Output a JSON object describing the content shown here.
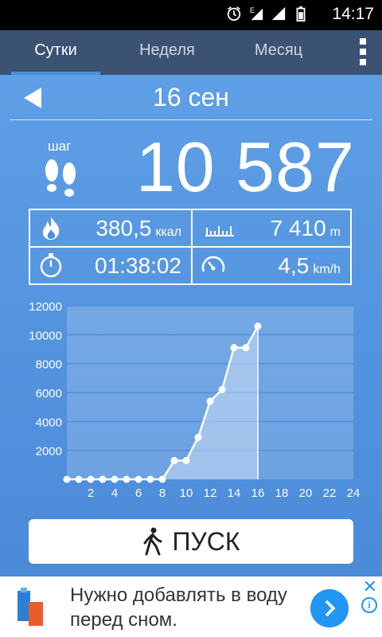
{
  "status_bar": {
    "time": "14:17",
    "network_label": "E"
  },
  "tabs": [
    {
      "label": "Сутки",
      "active": true
    },
    {
      "label": "Неделя",
      "active": false
    },
    {
      "label": "Месяц",
      "active": false
    }
  ],
  "date": "16 сен",
  "steps": {
    "label": "шаг",
    "value": "10 587"
  },
  "stats": {
    "energy": {
      "value": "380,5",
      "unit": "ккал"
    },
    "distance": {
      "value": "7 410",
      "unit": "m"
    },
    "duration": {
      "value": "01:38:02",
      "unit": ""
    },
    "speed": {
      "value": "4,5",
      "unit": "km/h"
    }
  },
  "start_button": {
    "label": "ПУСК"
  },
  "ad": {
    "text": "Нужно добавлять в воду перед сном.",
    "close": "✕",
    "info": "i"
  },
  "colors": {
    "background": "#4d8edb",
    "tabbar": "#3c5272",
    "ad_accent": "#2196f3"
  },
  "chart_data": {
    "type": "line",
    "x": [
      0,
      1,
      2,
      3,
      4,
      5,
      6,
      7,
      8,
      9,
      10,
      11,
      12,
      13,
      14,
      15,
      16
    ],
    "values": [
      0,
      0,
      0,
      0,
      0,
      0,
      0,
      0,
      0,
      1300,
      1300,
      2900,
      5400,
      6200,
      9100,
      9100,
      10587
    ],
    "xticks": [
      2,
      4,
      6,
      8,
      10,
      12,
      14,
      16,
      18,
      20,
      22,
      24
    ],
    "yticks": [
      2000,
      4000,
      6000,
      8000,
      10000,
      12000
    ],
    "xlim": [
      0,
      24
    ],
    "ylim": [
      0,
      12000
    ],
    "grid": true
  }
}
